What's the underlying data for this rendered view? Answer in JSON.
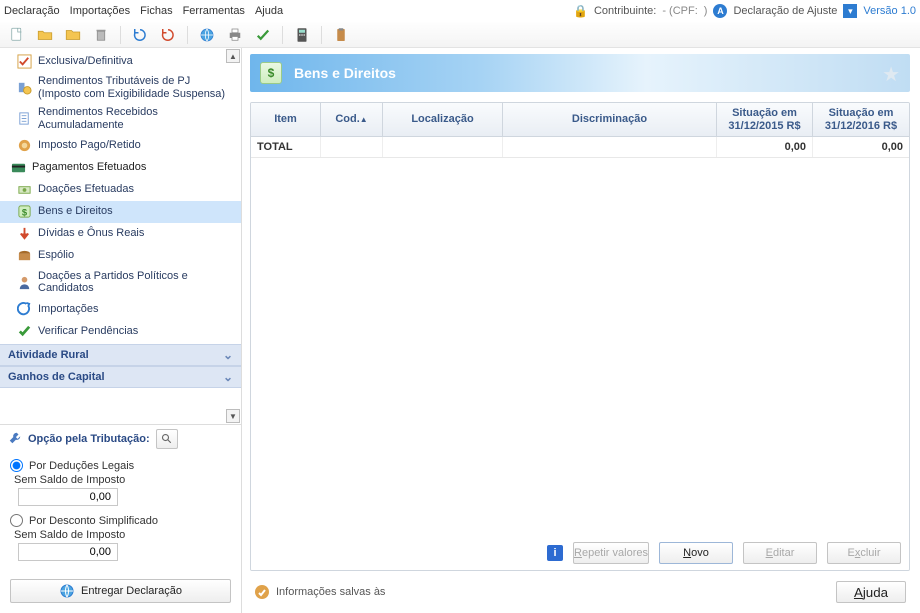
{
  "menubar": {
    "items": [
      "Declaração",
      "Importações",
      "Fichas",
      "Ferramentas",
      "Ajuda"
    ],
    "contribuinte_label": "Contribuinte:",
    "cpf_label": "- (CPF:",
    "cpf_close": ")",
    "declaracao_ajuste": "Declaração de Ajuste",
    "versao": "Versão 1.0"
  },
  "toolbar": {
    "icons": [
      "new-doc",
      "open-folder",
      "folder",
      "trash",
      "refresh-blue",
      "refresh-red",
      "globe",
      "print",
      "check",
      "calculator",
      "clipboard"
    ]
  },
  "sidebar": {
    "items": [
      {
        "icon": "excl",
        "label": "Exclusiva/Definitiva"
      },
      {
        "icon": "pj",
        "label": "Rendimentos Tributáveis de PJ (Imposto com Exigibilidade Suspensa)"
      },
      {
        "icon": "doc",
        "label": "Rendimentos Recebidos Acumuladamente"
      },
      {
        "icon": "lion",
        "label": "Imposto Pago/Retido"
      },
      {
        "icon": "card",
        "label": "Pagamentos Efetuados",
        "top": true
      },
      {
        "icon": "money",
        "label": "Doações Efetuadas"
      },
      {
        "icon": "dollar",
        "label": "Bens e Direitos",
        "active": true
      },
      {
        "icon": "down",
        "label": "Dívidas e Ônus Reais"
      },
      {
        "icon": "chest",
        "label": "Espólio"
      },
      {
        "icon": "person",
        "label": "Doações a Partidos Políticos e Candidatos"
      },
      {
        "icon": "import",
        "label": "Importações"
      },
      {
        "icon": "checkg",
        "label": "Verificar Pendências"
      }
    ],
    "sections": [
      {
        "label": "Atividade Rural"
      },
      {
        "label": "Ganhos de Capital"
      }
    ],
    "taxopt_label": "Opção pela Tributação:",
    "opt1": {
      "label": "Por Deduções Legais",
      "sub": "Sem Saldo de Imposto",
      "value": "0,00",
      "checked": true
    },
    "opt2": {
      "label": "Por Desconto Simplificado",
      "sub": "Sem Saldo de Imposto",
      "value": "0,00",
      "checked": false
    },
    "deliver": "Entregar Declaração"
  },
  "panel": {
    "title": "Bens e Direitos",
    "cols": {
      "item": "Item",
      "cod": "Cod.",
      "loc": "Localização",
      "disc": "Discriminação",
      "s1": "Situação em 31/12/2015 R$",
      "s2": "Situação em 31/12/2016 R$"
    },
    "total_row": {
      "label": "TOTAL",
      "s1": "0,00",
      "s2": "0,00"
    },
    "buttons": {
      "repetir": "Repetir valores",
      "novo": "Novo",
      "editar": "Editar",
      "excluir": "Excluir"
    },
    "info_save": "Informações salvas às",
    "ajuda": "Ajuda"
  }
}
